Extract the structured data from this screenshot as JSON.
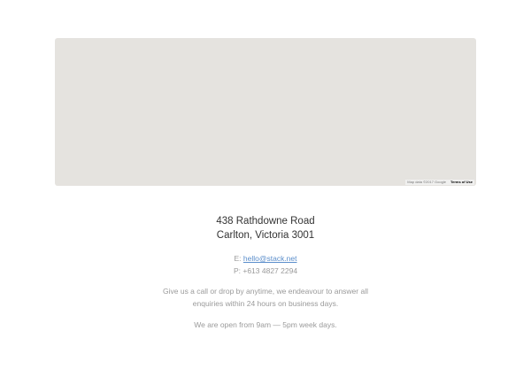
{
  "map": {
    "attribution": "Map data ©2017 Google",
    "terms_label": "Terms of Use",
    "background_color": "#e5e3df"
  },
  "address": {
    "line1": "438 Rathdowne Road",
    "line2": "Carlton, Victoria 3001"
  },
  "contact": {
    "email_prefix": "E:",
    "email": "hello@stack.net",
    "phone_prefix": "P:",
    "phone": "+613 4827 2294",
    "link_color": "#5b8ecb"
  },
  "blurb": {
    "line1": "Give us a call or drop by anytime, we endeavour to answer all",
    "line2": "enquiries within 24 hours on business days."
  },
  "hours": {
    "text": "We are open from 9am — 5pm week days."
  }
}
